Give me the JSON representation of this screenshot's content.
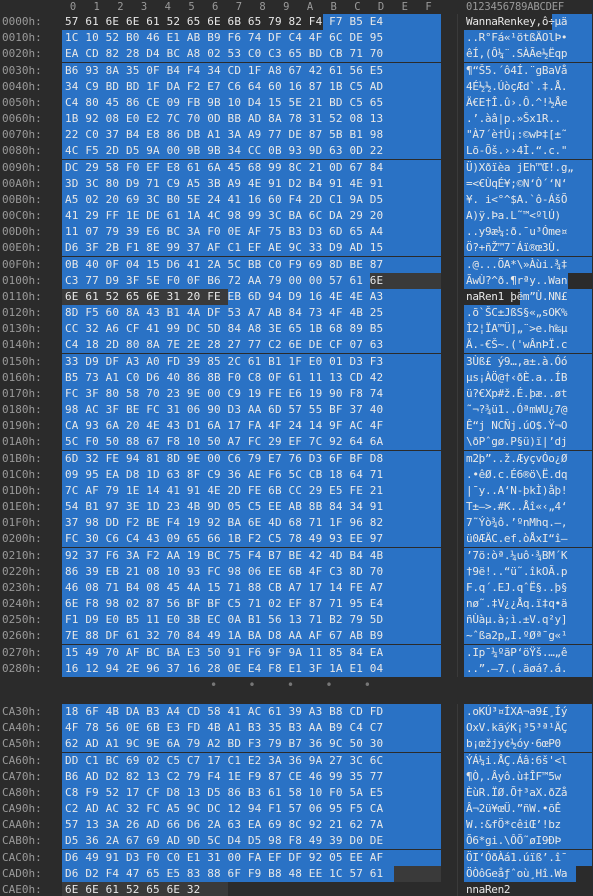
{
  "header": {
    "offset_label": "",
    "columns": [
      "0",
      "1",
      "2",
      "3",
      "4",
      "5",
      "6",
      "7",
      "8",
      "9",
      "A",
      "B",
      "C",
      "D",
      "E",
      "F"
    ],
    "ascii_label": "0123456789ABCDEF"
  },
  "top_rows": [
    {
      "off": "0000h:",
      "hex": "57 61 6E 6E 61 52 65 6E 6B 65 79 82 F4 F7 B5 E4",
      "asc": "WannaRenkey‚ô÷µä"
    },
    {
      "off": "0010h:",
      "hex": "1C 10 52 B0 46 E1 AB B9 F6 74 DF C4 4F 6C DE 95",
      "asc": "..R°Fá«¹ötßÄOlÞ•"
    },
    {
      "off": "0020h:",
      "hex": "EA CD 82 28 D4 BC A8 02 53 C0 C3 65 BD CB 71 70",
      "asc": "êÍ‚(Ô¼¨.SÀÃe½Ëqp"
    },
    {
      "off": "0030h:",
      "hex": "B6 93 8A 35 0F B4 F4 34 CD 1F A8 67 42 61 56 E5",
      "asc": "¶“Š5.´ô4Í.¨gBaVå"
    },
    {
      "off": "0040h:",
      "hex": "34 C9 BD BD 1F DA F2 E7 C6 64 60 16 87 1B C5 AD",
      "asc": "4É½½.ÚòçÆd`.‡.Å."
    },
    {
      "off": "0050h:",
      "hex": "C4 80 45 86 CE 09 FB 9B 10 D4 15 5E 21 BD C5 65",
      "asc": "Ä€E†Î.û›.Ô.^!½Åe"
    },
    {
      "off": "0060h:",
      "hex": "1B 92 08 E0 E2 7C 70 0D BB AD 8A 78 31 52 08 13",
      "asc": ".’.àâ|p.»­Šx1R.."
    },
    {
      "off": "0070h:",
      "hex": "22 C0 37 B4 E8 86 DB A1 3A A9 77 DE 87 5B B1 98",
      "asc": "\"À7´è†Û¡:©wÞ‡[±˜"
    },
    {
      "off": "0080h:",
      "hex": "4C F5 2D D5 9A 00 9B 9B 34 CC 0B 93 9D 63 0D 22",
      "asc": "Lõ-Õš.››4Ì.“.c.\""
    },
    {
      "off": "0090h:",
      "hex": "DC 29 58 F0 EF E8 61 6A 45 68 99 8C 21 0D 67 84",
      "asc": "Ü)Xðïèa jEh™Œ!.g„"
    },
    {
      "off": "00A0h:",
      "hex": "3D 3C 80 D9 71 C9 A5 3B A9 4E 91 D2 B4 91 4E 91",
      "asc": "=<€ÙqÉ¥;©N‘Ò´‘N‘"
    },
    {
      "off": "00B0h:",
      "hex": "A5 02 20 69 3C B0 5E 24 41 16 60 F4 2D C1 9A D5",
      "asc": "¥. i<°^$A.`ô-ÁšÕ"
    },
    {
      "off": "00C0h:",
      "hex": "41 29 FF 1E DE 61 1A 4C 98 99 3C BA 6C DA 29 20",
      "asc": "A)ÿ.Þa.L˜™<ºlÚ) "
    },
    {
      "off": "00D0h:",
      "hex": "11 07 79 39 E6 BC 3A F0 0E AF 75 B3 D3 6D 65 A4",
      "asc": "..y9æ¼:ð.¯u³Óme¤"
    },
    {
      "off": "00E0h:",
      "hex": "D6 3F 2B F1 8E 99 37 AF C1 EF AE 9C 33 D9 AD 15",
      "asc": "Ö?+ñŽ™7¯Áï®œ3Ù­."
    },
    {
      "off": "00F0h:",
      "hex": "0B 40 0F 04 15 D6 41 2A 5C BB C0 F9 69 8D BE 87",
      "asc": ".@...ÖA*\\»Àùi.¾‡"
    },
    {
      "off": "0100h:",
      "hex": "C3 77 D9 3F 5E F0 0F B6 72 AA 79 00 00 57 61 6E",
      "asc": "ÃwÙ?^ð.¶rªy..Wan"
    },
    {
      "off": "0110h:",
      "hex": "6E 61 52 65 6E 31 20 FE EB 6D 94 D9 16 4E 4E A3",
      "asc": "naRen1 þëm”Ù.NN£"
    },
    {
      "off": "0120h:",
      "hex": "8D F5 60 8A 43 B1 4A DF 53 A7 AB 84 73 4F 4B 25",
      "asc": ".õ`ŠC±JßS§«„sOK%"
    },
    {
      "off": "0130h:",
      "hex": "CC 32 A6 CF 41 99 DC 5D 84 A8 3E 65 1B 68 89 B5",
      "asc": "Ì2¦ÏA™Ü]„¨>e.h‰µ"
    },
    {
      "off": "0140h:",
      "hex": "C4 18 2D 80 8A 7E 2E 28 27 77 C2 6E DE CF 07 63",
      "asc": "Ä.-€Š~.('wÂnÞÏ.c"
    },
    {
      "off": "0150h:",
      "hex": "33 D9 DF A3 A0 FD 39 85 2C 61 B1 1F E0 01 D3 F3",
      "asc": "3Ùß£ ý9…,a±.à.Óó"
    },
    {
      "off": "0160h:",
      "hex": "B5 73 A1 C0 D6 40 86 8B F0 C8 0F 61 11 13 CD 42",
      "asc": "µs¡ÀÖ@†‹ðÈ.a..ÍB"
    },
    {
      "off": "0170h:",
      "hex": "FC 3F 80 58 70 23 9E 00 C9 19 FE E6 19 90 F8 74",
      "asc": "ü?€Xp#ž.É.þæ..øt"
    },
    {
      "off": "0180h:",
      "hex": "98 AC 3F BE FC 31 06 90 D3 AA 6D 57 55 BF 37 40",
      "asc": "˜¬?¾ü1..ÓªmWU¿7@"
    },
    {
      "off": "0190h:",
      "hex": "CA 93 6A 20 4E 43 D1 6A 17 FA 4F 24 14 9F AC 4F",
      "asc": "Ê“j NCÑj.úO$.Ÿ¬O"
    },
    {
      "off": "01A0h:",
      "hex": "5C F0 50 88 67 F8 10 50 A7 FC 29 EF 7C 92 64 6A",
      "asc": "\\ðPˆgø.P§ü)ï|’dj"
    },
    {
      "off": "01B0h:",
      "hex": "6D 32 FE 94 81 8D 9E 00 C6 79 E7 76 D3 6F BF D8",
      "asc": "m2þ”..ž.ÆyçvÓo¿Ø"
    },
    {
      "off": "01C0h:",
      "hex": "09 95 EA D8 1D 63 8F C9 36 AE F6 5C CB 18 64 71",
      "asc": ".•êØ.c.É6®ö\\Ë.dq"
    },
    {
      "off": "01D0h:",
      "hex": "7C AF 79 1E 14 41 91 4E 2D FE 6B CC 29 E5 FE 21",
      "asc": "|¯y..A‘N-þkÌ)åþ!"
    },
    {
      "off": "01E0h:",
      "hex": "54 B1 97 3E 1D 23 4B 9D 05 C5 EE AB 8B 84 34 91",
      "asc": "T±—>.#K..Åî«‹„4‘"
    },
    {
      "off": "01F0h:",
      "hex": "37 98 DD F2 BE F4 19 92 BA 6E 4D 68 71 1F 96 82",
      "asc": "7˜Ýò¾ô.’ºnMhq.–‚"
    },
    {
      "off": "0200h:",
      "hex": "FC 30 C6 C4 43 09 65 66 1B F2 C5 78 49 93 EE 97",
      "asc": "ü0ÆÄC.ef.òÅxI“î—"
    },
    {
      "off": "0210h:",
      "hex": "92 37 F6 3A F2 AA 19 BC 75 F4 B7 BE 42 4D B4 4B",
      "asc": "’7ö:òª.¼uô·¾BM´K"
    },
    {
      "off": "0220h:",
      "hex": "86 39 EB 21 08 10 93 FC 98 06 EE 6B 4F C3 8D 70",
      "asc": "†9ë!..“ü˜.îkOÃ.p"
    },
    {
      "off": "0230h:",
      "hex": "46 08 71 B4 08 45 4A 15 71 88 CB A7 17 14 FE A7",
      "asc": "F.q´.EJ.qˆË§..þ§"
    },
    {
      "off": "0240h:",
      "hex": "6E F8 98 02 87 56 BF BF C5 71 02 EF 87 71 95 E4",
      "asc": "nø˜.‡V¿¿Åq.ï‡q•ä"
    },
    {
      "off": "0250h:",
      "hex": "F1 D9 E0 B5 11 E0 3B EC 0A B1 56 13 71 B2 79 5D",
      "asc": "ñÙàµ.à;ì.±V.q²y]"
    },
    {
      "off": "0260h:",
      "hex": "7E 88 DF 61 32 70 84 49 1A BA D8 AA AF 67 AB B9",
      "asc": "~ˆßa2p„I.ºØª¯g«¹"
    },
    {
      "off": "0270h:",
      "hex": "15 49 70 AF BC BA E3 50 91 F6 9F 9A 11 85 84 EA",
      "asc": ".Ip¯¼ºãP‘öŸš.…„ê"
    },
    {
      "off": "0280h:",
      "hex": "16 12 94 2E 96 37 16 28 0E E4 F8 E1 3F 1A E1 04",
      "asc": "..”.–7.(.äøá?.á."
    }
  ],
  "separator": "• • • • •",
  "bottom_rows": [
    {
      "off": "CA30h:",
      "hex": "18 6F 4B DA B3 A4 CD 58 41 AC 61 39 A3 B8 CD FD",
      "asc": ".oKÚ³¤ÍXA¬a9£¸Íý"
    },
    {
      "off": "CA40h:",
      "hex": "4F 78 56 0E 6B E3 FD 4B A1 B3 35 B3 AA B9 C4 C7",
      "asc": "OxV.kãýK¡³5³ª¹ÄÇ"
    },
    {
      "off": "CA50h:",
      "hex": "62 AD A1 9C 9E 6A 79 A2 BD F3 79 B7 36 9C 50 30",
      "asc": "b­¡œžjy¢½óy·6œP0"
    },
    {
      "off": "CA60h:",
      "hex": "DD C1 BC 69 02 C5 C7 17 C1 E2 3A 36 9A 27 3C 6C",
      "asc": "ÝÁ¼i.ÅÇ.Áâ:6š'<l"
    },
    {
      "off": "CA70h:",
      "hex": "B6 AD D2 82 13 C2 79 F4 1E F9 87 CE 46 99 35 77",
      "asc": "¶­Ò‚.Âyô.ù‡ÎF™5w"
    },
    {
      "off": "CA80h:",
      "hex": "C8 F9 52 17 CF D8 13 D5 86 B3 61 58 10 F0 5A E5",
      "asc": "ÈùR.ÏØ.Õ†³aX.ðZå"
    },
    {
      "off": "CA90h:",
      "hex": "C2 AD AC 32 FC A5 9C DC 12 94 F1 57 06 95 F5 CA",
      "asc": "Â­¬2ü¥œÜ.”ñW.•õÊ"
    },
    {
      "off": "CAA0h:",
      "hex": "57 13 3A 26 AD 66 D6 2A 63 EA 69 8C 92 21 62 7A",
      "asc": "W.:&­fÖ*cêiŒ’!bz"
    },
    {
      "off": "CAB0h:",
      "hex": "D5 36 2A 67 69 AD 9D 5C D4 D5 98 F8 49 39 D0 DE",
      "asc": "Õ6*gi­.\\ÔÕ˜øI9ÐÞ"
    },
    {
      "off": "CAC0h:",
      "hex": "D6 49 91 D3 F0 C0 E1 31 00 FA EF DF 92 05 EE AF",
      "asc": "ÖI‘ÓðÀá1.úïß’.î¯"
    },
    {
      "off": "CAD0h:",
      "hex": "D6 D2 F4 47 65 E5 83 88 6F F9 B8 48 EE 1C 57 61",
      "asc": "ÖÒôGeåƒˆoù¸Hî.Wa"
    },
    {
      "off": "CAE0h:",
      "hex": "6E 6E 61 52 65 6E 32",
      "asc": "nnaRen2"
    }
  ]
}
